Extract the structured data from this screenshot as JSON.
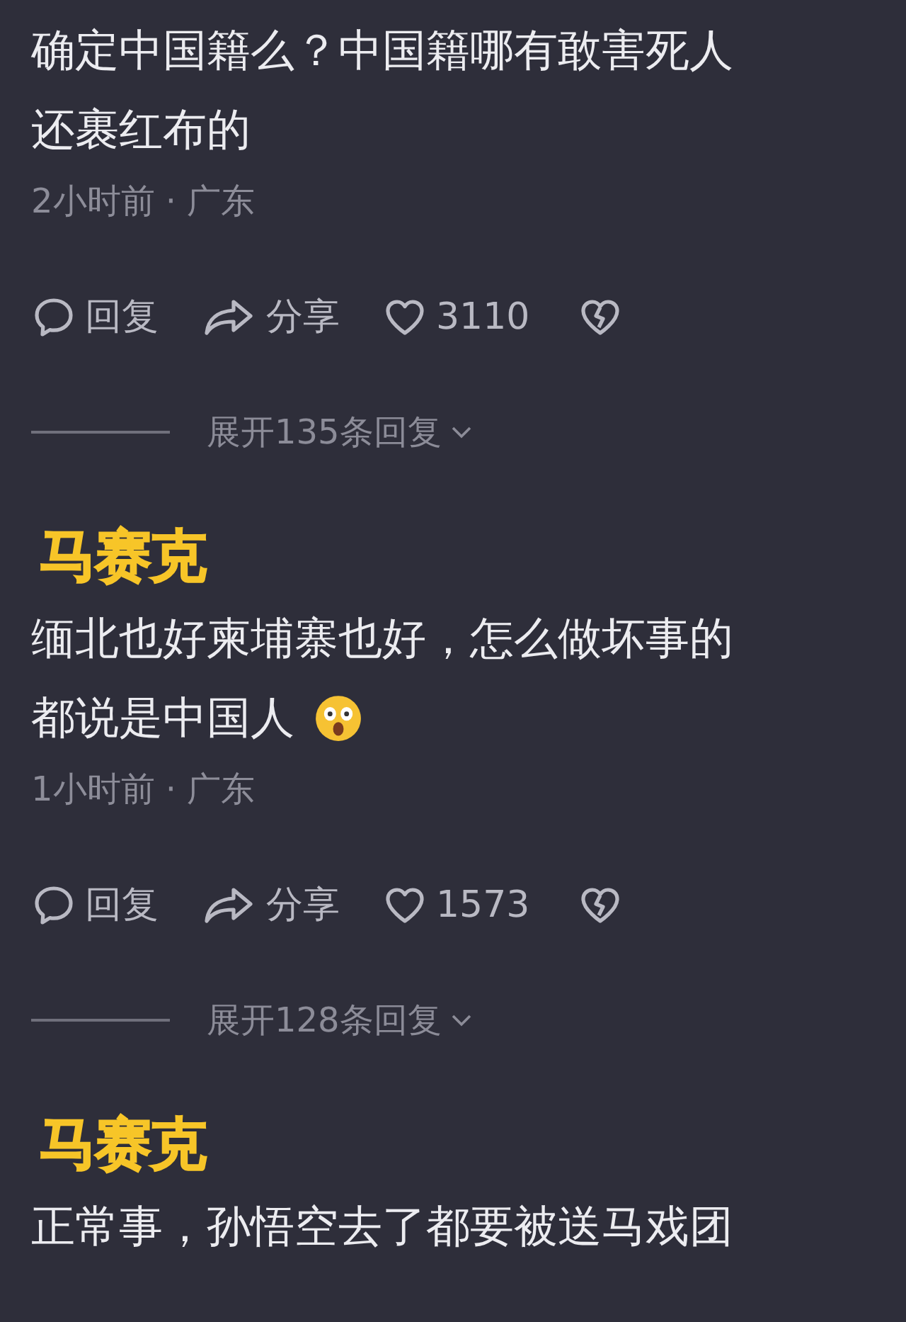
{
  "comments": [
    {
      "lines": [
        "确定中国籍么？中国籍哪有敢害死人",
        "还裹红布的"
      ],
      "meta": "2小时前 · 广东",
      "actions": {
        "reply": "回复",
        "share": "分享",
        "likes": "3110"
      },
      "expand": "展开135条回复"
    },
    {
      "censor_label": "马赛克",
      "lines": [
        "缅北也好柬埔寨也好，怎么做坏事的",
        "都说是中国人"
      ],
      "emoji": true,
      "meta": "1小时前 · 广东",
      "actions": {
        "reply": "回复",
        "share": "分享",
        "likes": "1573"
      },
      "expand": "展开128条回复"
    },
    {
      "censor_label": "马赛克",
      "lines": [
        "正常事，孙悟空去了都要被送马戏团"
      ]
    }
  ]
}
